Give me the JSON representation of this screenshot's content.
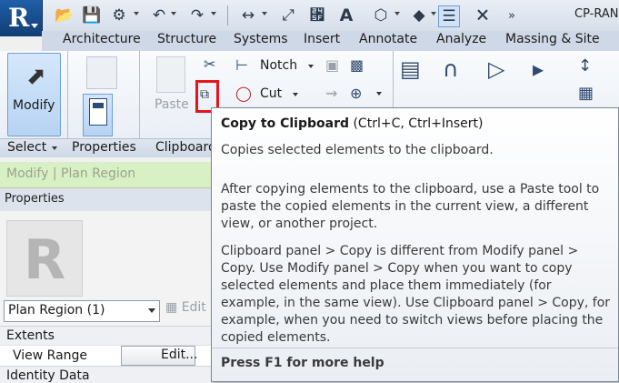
{
  "app": {
    "title": "CP-RAN"
  },
  "ribbon": {
    "tabs": [
      "Architecture",
      "Structure",
      "Systems",
      "Insert",
      "Annotate",
      "Analyze",
      "Massing & Site"
    ],
    "modify_label": "Modify",
    "paste_label": "Paste",
    "notch_label": "Notch",
    "cut_label": "Cut",
    "panels": {
      "select": "Select",
      "properties": "Properties",
      "clipboard": "Clipboard"
    }
  },
  "context_bar": {
    "label": "Modify | Plan Region"
  },
  "properties": {
    "header": "Properties",
    "type_selector": "Plan Region (1)",
    "edit_type": "Edit",
    "category": "Extents",
    "row_label": "View Range",
    "edit_button": "Edit...",
    "next_category": "Identity Data"
  },
  "tooltip": {
    "title": "Copy to Clipboard",
    "shortcut": "(Ctrl+C, Ctrl+Insert)",
    "summary": "Copies selected elements to the clipboard.",
    "paragraph1": "After copying elements to the clipboard, use a Paste tool to paste the copied elements in the current view, a different view, or another project.",
    "paragraph2": "Clipboard panel > Copy is different from Modify panel > Copy. Use Modify panel > Copy when you want to copy selected elements and place them immediately (for example, in the same view). Use Clipboard panel > Copy, for example, when you need to switch views before placing the copied elements.",
    "help": "Press F1 for more help"
  },
  "colors": {
    "highlight": "#e8141c",
    "context_green": "#d9f0c4",
    "app_blue": "#1f5fa8"
  }
}
